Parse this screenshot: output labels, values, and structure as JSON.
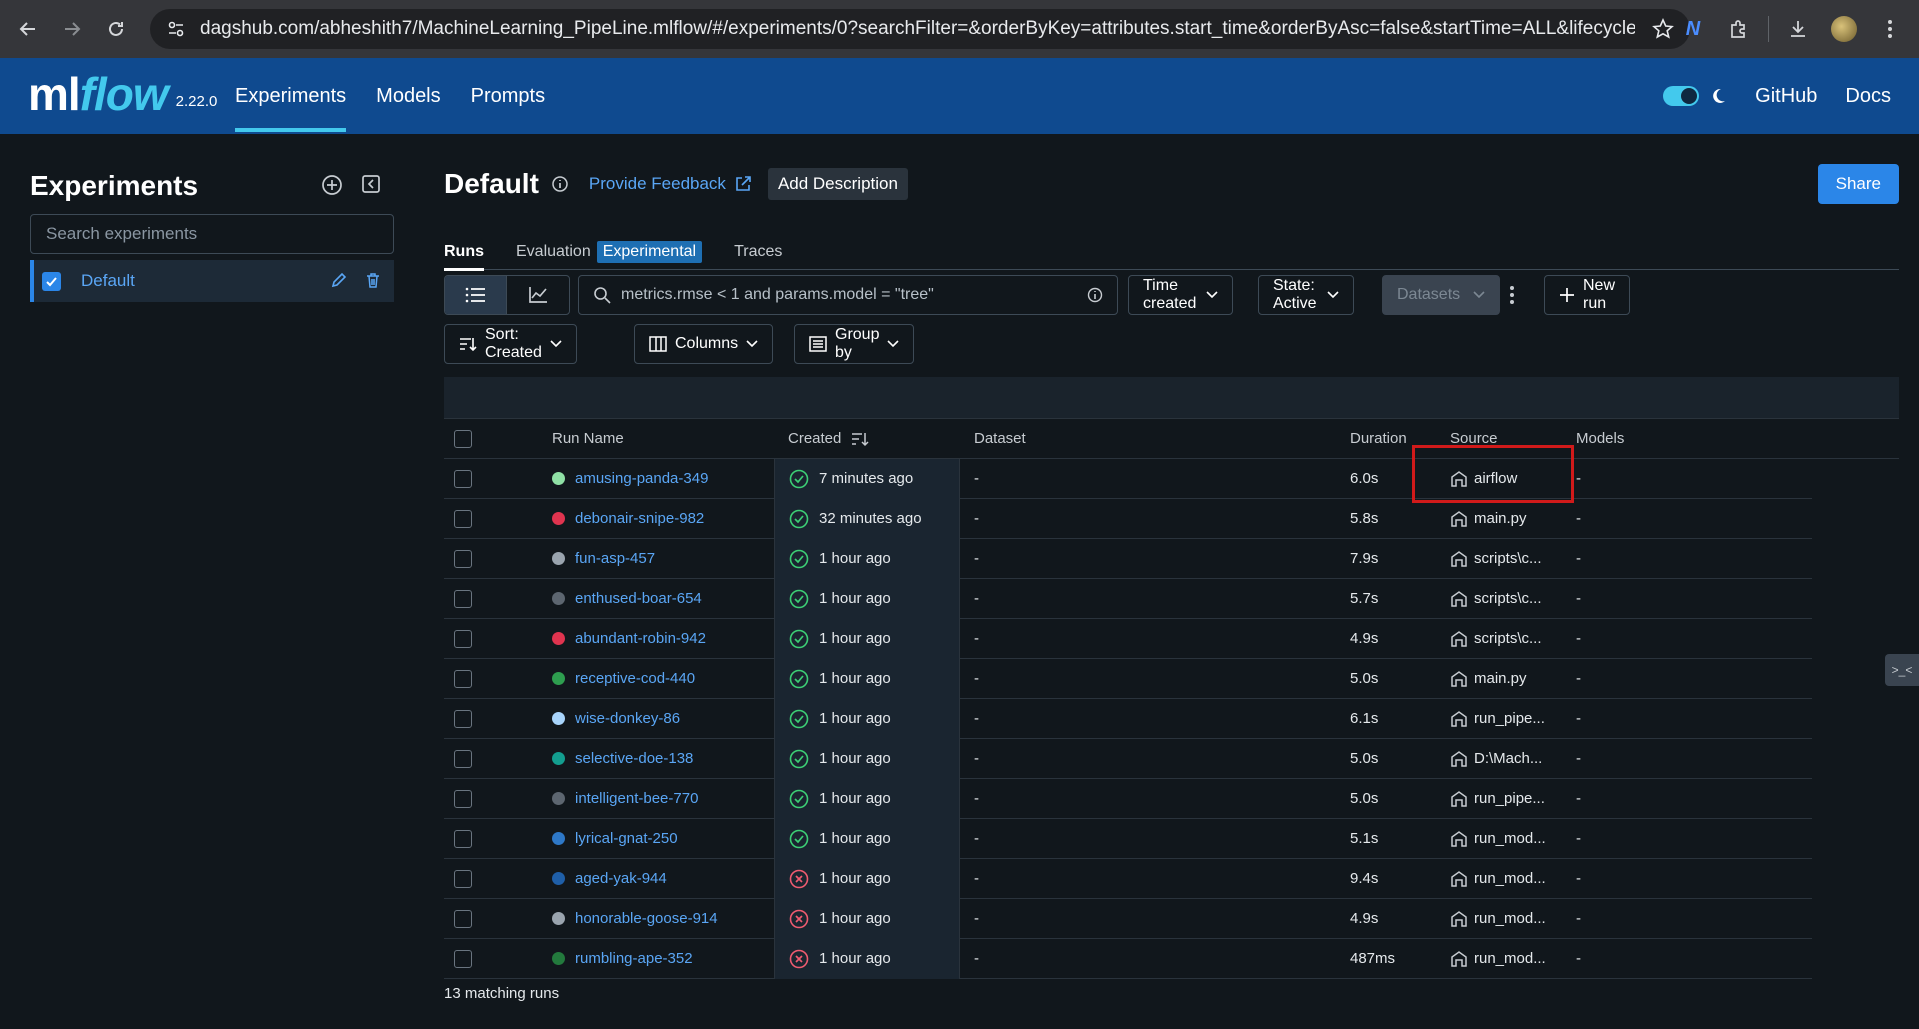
{
  "browser": {
    "url": "dagshub.com/abheshith7/MachineLearning_PipeLine.mlflow/#/experiments/0?searchFilter=&orderByKey=attributes.start_time&orderByAsc=false&startTime=ALL&lifecycleFilter=Ac..."
  },
  "app": {
    "logo_ml": "ml",
    "logo_flow": "flow",
    "version": "2.22.0",
    "nav": [
      "Experiments",
      "Models",
      "Prompts"
    ],
    "github": "GitHub",
    "docs": "Docs",
    "accent": "#43c9ed",
    "header_bg": "#0f4a8f"
  },
  "sidebar": {
    "title": "Experiments",
    "search_placeholder": "Search experiments",
    "items": [
      {
        "label": "Default",
        "checked": true
      }
    ]
  },
  "main": {
    "title": "Default",
    "feedback": "Provide Feedback",
    "add_description": "Add Description",
    "share": "Share",
    "tabs": {
      "runs": "Runs",
      "evaluation": "Evaluation",
      "experimental": "Experimental",
      "traces": "Traces"
    },
    "search_query": "metrics.rmse < 1 and params.model = \"tree\"",
    "time_created": "Time created",
    "state": "State: Active",
    "datasets": "Datasets",
    "new_run": "New run",
    "sort": "Sort: Created",
    "columns": "Columns",
    "group_by": "Group by",
    "matching": "13 matching runs"
  },
  "table": {
    "headers": {
      "run_name": "Run Name",
      "created": "Created",
      "dataset": "Dataset",
      "duration": "Duration",
      "source": "Source",
      "models": "Models"
    },
    "rows": [
      {
        "name": "amusing-panda-349",
        "color": "#8fe0a5",
        "status": "ok",
        "created": "7 minutes ago",
        "dataset": "-",
        "duration": "6.0s",
        "source": "airflow",
        "models": "-"
      },
      {
        "name": "debonair-snipe-982",
        "color": "#e0344f",
        "status": "ok",
        "created": "32 minutes ago",
        "dataset": "-",
        "duration": "5.8s",
        "source": "main.py",
        "models": "-"
      },
      {
        "name": "fun-asp-457",
        "color": "#9aa4ae",
        "status": "ok",
        "created": "1 hour ago",
        "dataset": "-",
        "duration": "7.9s",
        "source": "scripts\\c...",
        "models": "-"
      },
      {
        "name": "enthused-boar-654",
        "color": "#5d6670",
        "status": "ok",
        "created": "1 hour ago",
        "dataset": "-",
        "duration": "5.7s",
        "source": "scripts\\c...",
        "models": "-"
      },
      {
        "name": "abundant-robin-942",
        "color": "#e0344f",
        "status": "ok",
        "created": "1 hour ago",
        "dataset": "-",
        "duration": "4.9s",
        "source": "scripts\\c...",
        "models": "-"
      },
      {
        "name": "receptive-cod-440",
        "color": "#2e9e4f",
        "status": "ok",
        "created": "1 hour ago",
        "dataset": "-",
        "duration": "5.0s",
        "source": "main.py",
        "models": "-"
      },
      {
        "name": "wise-donkey-86",
        "color": "#a8d4fb",
        "status": "ok",
        "created": "1 hour ago",
        "dataset": "-",
        "duration": "6.1s",
        "source": "run_pipe...",
        "models": "-"
      },
      {
        "name": "selective-doe-138",
        "color": "#139e8f",
        "status": "ok",
        "created": "1 hour ago",
        "dataset": "-",
        "duration": "5.0s",
        "source": "D:\\Mach...",
        "models": "-"
      },
      {
        "name": "intelligent-bee-770",
        "color": "#5d6670",
        "status": "ok",
        "created": "1 hour ago",
        "dataset": "-",
        "duration": "5.0s",
        "source": "run_pipe...",
        "models": "-"
      },
      {
        "name": "lyrical-gnat-250",
        "color": "#2e78c7",
        "status": "ok",
        "created": "1 hour ago",
        "dataset": "-",
        "duration": "5.1s",
        "source": "run_mod...",
        "models": "-"
      },
      {
        "name": "aged-yak-944",
        "color": "#1f5fa8",
        "status": "fail",
        "created": "1 hour ago",
        "dataset": "-",
        "duration": "9.4s",
        "source": "run_mod...",
        "models": "-"
      },
      {
        "name": "honorable-goose-914",
        "color": "#9aa4ae",
        "status": "fail",
        "created": "1 hour ago",
        "dataset": "-",
        "duration": "4.9s",
        "source": "run_mod...",
        "models": "-"
      },
      {
        "name": "rumbling-ape-352",
        "color": "#237a3d",
        "status": "fail",
        "created": "1 hour ago",
        "dataset": "-",
        "duration": "487ms",
        "source": "run_mod...",
        "models": "-"
      }
    ]
  }
}
